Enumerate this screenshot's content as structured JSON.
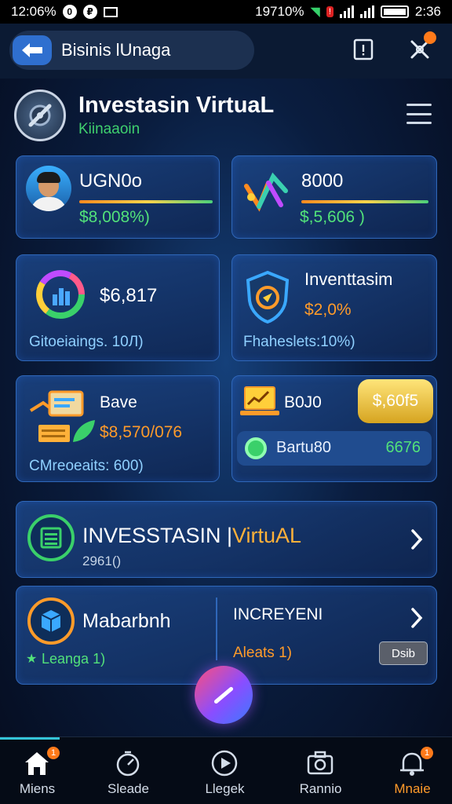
{
  "status_bar": {
    "time_left": "12:06%",
    "percent": "19710%",
    "time_right": "2:36"
  },
  "app_bar": {
    "title": "Bisinis lUnaga"
  },
  "header": {
    "title": "Investasin VirtuaL",
    "subtitle": "Kiinaaoin"
  },
  "cards": {
    "profile": {
      "name": "UGN0o",
      "value": "$8,008%)"
    },
    "logo_card": {
      "value": "8000",
      "sub": "$,5,606 )"
    },
    "holdings": {
      "value": "$6,817",
      "label": "Gitoeiaings. 10Л)"
    },
    "investasin": {
      "title": "Inventtasim",
      "value": "$2,0%",
      "label": "Fhaheslets:10%)"
    },
    "save": {
      "title": "Bave",
      "value": "$8,570/076",
      "label": "CMreoeaits: 600)"
    },
    "bojo": {
      "title": "B0J0",
      "button": "$,60f5"
    },
    "bartu": {
      "label": "Bartu80",
      "value": "6676"
    }
  },
  "invest_banner": {
    "title_white": "INVESSTASIN |",
    "title_orange": "VirtuAL",
    "sub": "2961()"
  },
  "bottom_card": {
    "left_title": "Mabarbnh",
    "left_sub": "Leanga 1)",
    "right_title": "INCREYENI",
    "right_sub": "Aleats 1)",
    "button": "Dsib"
  },
  "bottom_nav": [
    {
      "label": "Miens",
      "icon": "home-icon",
      "badge": "1"
    },
    {
      "label": "Sleade",
      "icon": "timer-icon"
    },
    {
      "label": "Llegek",
      "icon": "play-icon"
    },
    {
      "label": "Rannio",
      "icon": "camera-icon"
    },
    {
      "label": "Mnaie",
      "icon": "bell-icon",
      "badge": "1"
    }
  ],
  "colors": {
    "accent_blue": "#2f6fcf",
    "accent_green": "#52e27a",
    "accent_orange": "#ff9b2a",
    "card_border": "#2f67b9"
  }
}
